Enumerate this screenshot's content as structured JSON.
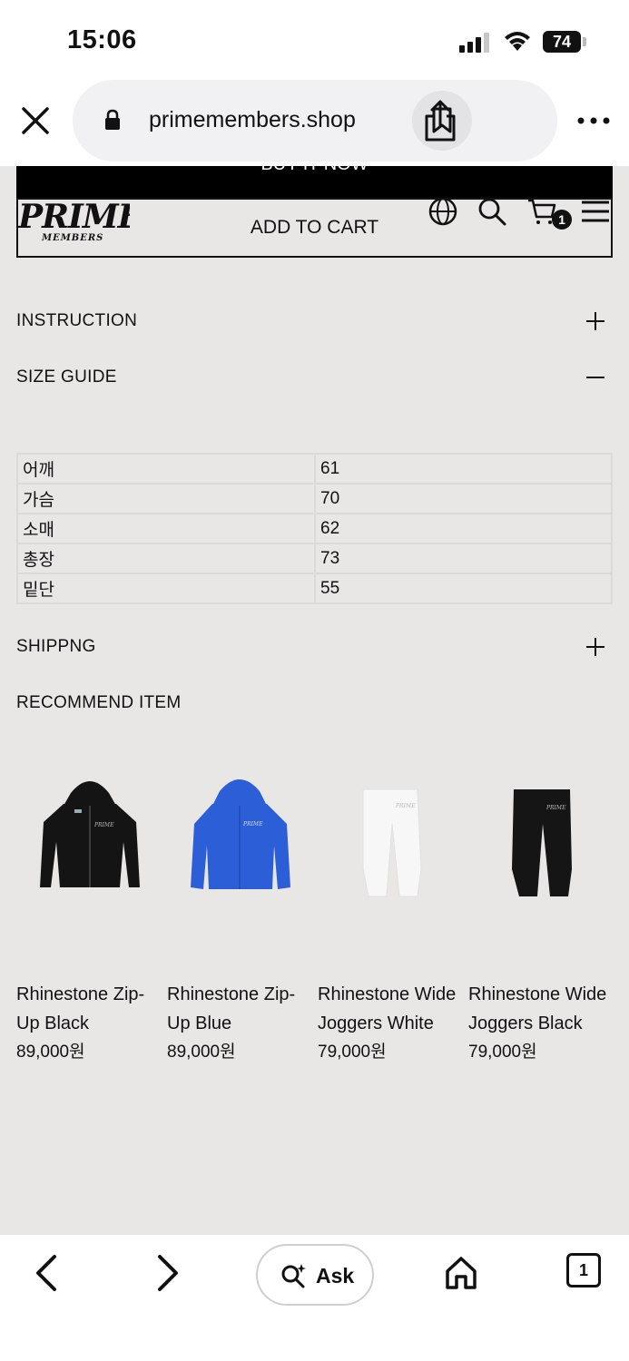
{
  "status_bar": {
    "time": "15:06",
    "battery": "74"
  },
  "browser": {
    "url": "primemembers.shop"
  },
  "header": {
    "buy_now_label": "BUY IT NOW",
    "add_to_cart_label": "ADD TO CART",
    "cart_count": "1",
    "logo_text": "PRIME MEMBERS"
  },
  "accordion": {
    "instruction": "INSTRUCTION",
    "size_guide": "SIZE GUIDE",
    "shipping": "SHIPPNG"
  },
  "size_table": [
    {
      "label": "어깨",
      "value": "61"
    },
    {
      "label": "가슴",
      "value": "70"
    },
    {
      "label": "소매",
      "value": "62"
    },
    {
      "label": "총장",
      "value": "73"
    },
    {
      "label": "밑단",
      "value": "55"
    }
  ],
  "recommend": {
    "title": "RECOMMEND ITEM",
    "items": [
      {
        "name": "Rhinestone Zip-Up Black",
        "price": "89,000원",
        "color": "#141414"
      },
      {
        "name": "Rhinestone Zip-Up Blue",
        "price": "89,000원",
        "color": "#2c5ed8"
      },
      {
        "name": "Rhinestone Wide Joggers White",
        "price": "79,000원",
        "color": "#f7f7f7"
      },
      {
        "name": "Rhinestone Wide Joggers Black",
        "price": "79,000원",
        "color": "#151515"
      }
    ]
  },
  "toolbar": {
    "ask_label": "Ask",
    "tab_count": "1"
  }
}
